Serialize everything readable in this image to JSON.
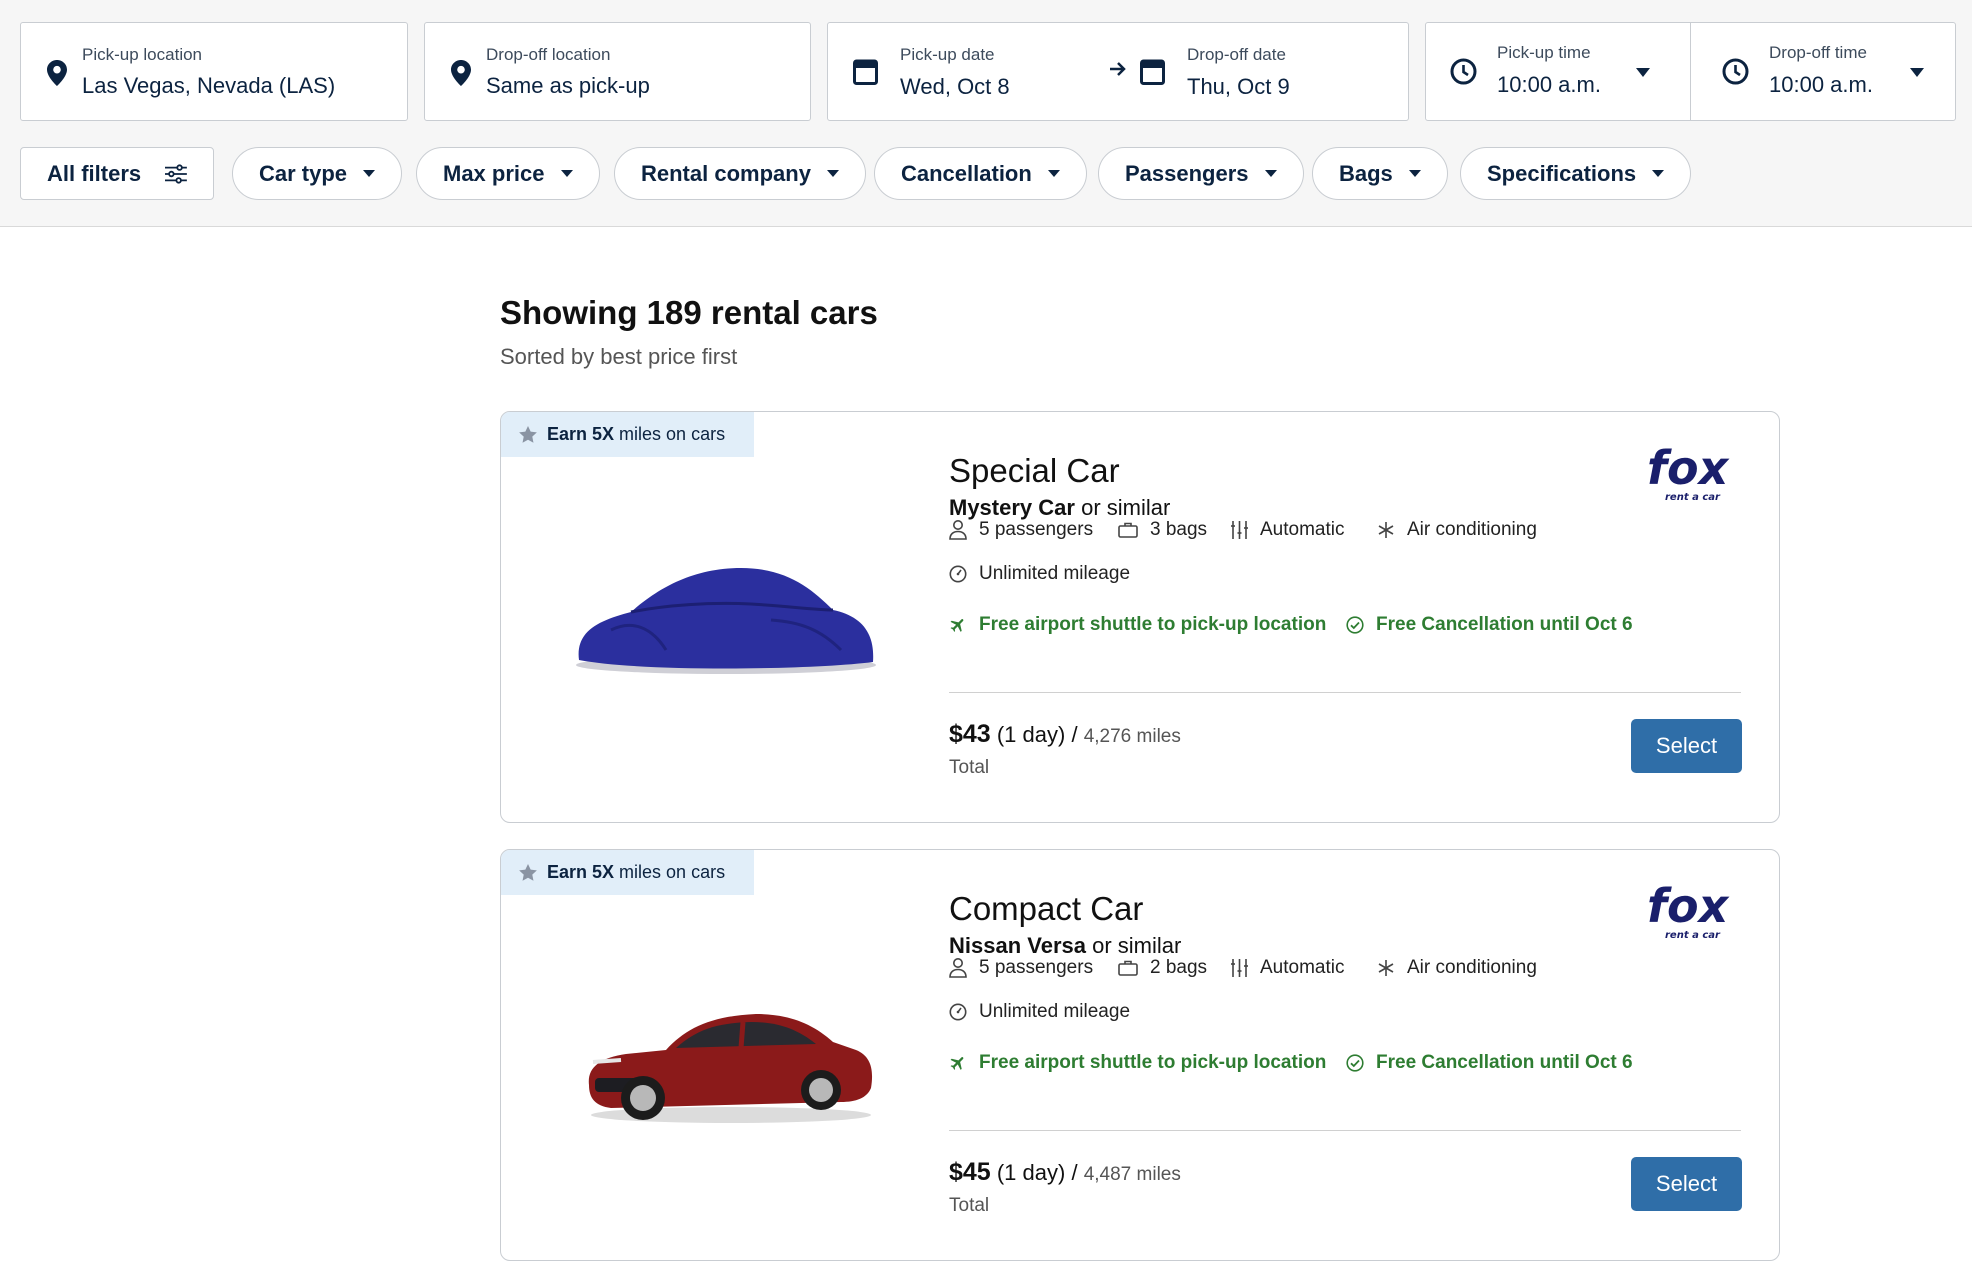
{
  "search": {
    "pickup_location": {
      "label": "Pick-up location",
      "value": "Las Vegas, Nevada (LAS)"
    },
    "dropoff_location": {
      "label": "Drop-off location",
      "value": "Same as pick-up"
    },
    "pickup_date": {
      "label": "Pick-up date",
      "value": "Wed, Oct 8"
    },
    "dropoff_date": {
      "label": "Drop-off date",
      "value": "Thu, Oct 9"
    },
    "pickup_time": {
      "label": "Pick-up time",
      "value": "10:00 a.m."
    },
    "dropoff_time": {
      "label": "Drop-off time",
      "value": "10:00 a.m."
    }
  },
  "filters": {
    "all_filters": "All filters",
    "chips": [
      "Car type",
      "Max price",
      "Rental company",
      "Cancellation",
      "Passengers",
      "Bags",
      "Specifications"
    ]
  },
  "results": {
    "title": "Showing 189 rental cars",
    "subtitle": "Sorted by best price first"
  },
  "cars": [
    {
      "promo_bold": "Earn 5X",
      "promo_rest": "miles on cars",
      "class": "Special Car",
      "model": "Mystery Car",
      "model_suffix": "or similar",
      "passengers": "5 passengers",
      "bags": "3 bags",
      "transmission": "Automatic",
      "ac": "Air conditioning",
      "mileage": "Unlimited mileage",
      "shuttle": "Free airport shuttle to pick-up location",
      "cancellation": "Free Cancellation until Oct 6",
      "price": "$43",
      "duration": "(1 day)",
      "separator": "/",
      "award_miles": "4,276 miles",
      "total_label": "Total",
      "select_label": "Select",
      "vendor": "fox rent a car",
      "car_color": "#2b2f9e"
    },
    {
      "promo_bold": "Earn 5X",
      "promo_rest": "miles on cars",
      "class": "Compact Car",
      "model": "Nissan Versa",
      "model_suffix": "or similar",
      "passengers": "5 passengers",
      "bags": "2 bags",
      "transmission": "Automatic",
      "ac": "Air conditioning",
      "mileage": "Unlimited mileage",
      "shuttle": "Free airport shuttle to pick-up location",
      "cancellation": "Free Cancellation until Oct 6",
      "price": "$45",
      "duration": "(1 day)",
      "separator": "/",
      "award_miles": "4,487 miles",
      "total_label": "Total",
      "select_label": "Select",
      "vendor": "fox rent a car",
      "car_color": "#8b1a1a"
    }
  ],
  "colors": {
    "navy": "#0c2340",
    "accent_blue": "#2f6ea8",
    "green": "#2e7d32",
    "promo_bg": "#e1eef9"
  },
  "icons": [
    "location-pin-icon",
    "calendar-icon",
    "arrow-right-icon",
    "clock-icon",
    "caret-down-icon",
    "filter-sliders-icon",
    "star-icon",
    "person-icon",
    "bag-icon",
    "transmission-icon",
    "snowflake-icon",
    "speedometer-icon",
    "airplane-icon",
    "check-circle-icon"
  ]
}
